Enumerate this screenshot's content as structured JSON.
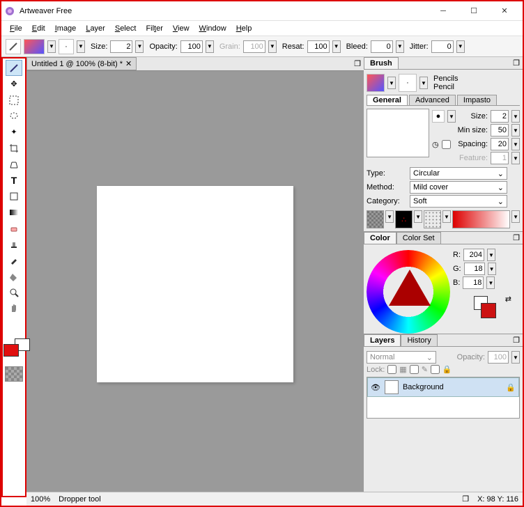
{
  "app": {
    "title": "Artweaver Free"
  },
  "menu": {
    "file": "File",
    "edit": "Edit",
    "image": "Image",
    "layer": "Layer",
    "select": "Select",
    "filter": "Filter",
    "view": "View",
    "window": "Window",
    "help": "Help"
  },
  "options": {
    "size_label": "Size:",
    "size": "2",
    "opacity_label": "Opacity:",
    "opacity": "100",
    "grain_label": "Grain:",
    "grain": "100",
    "resat_label": "Resat:",
    "resat": "100",
    "bleed_label": "Bleed:",
    "bleed": "0",
    "jitter_label": "Jitter:",
    "jitter": "0"
  },
  "doc": {
    "tab": "Untitled 1 @ 100% (8-bit) *"
  },
  "brush": {
    "panel": "Brush",
    "variant_group": "Pencils",
    "variant": "Pencil",
    "sub": {
      "general": "General",
      "advanced": "Advanced",
      "impasto": "Impasto"
    },
    "size_label": "Size:",
    "size": "2",
    "minsize_label": "Min size:",
    "minsize": "50",
    "spacing_label": "Spacing:",
    "spacing": "20",
    "feature_label": "Feature:",
    "feature": "1",
    "type_label": "Type:",
    "type": "Circular",
    "method_label": "Method:",
    "method": "Mild cover",
    "category_label": "Category:",
    "category": "Soft"
  },
  "color": {
    "panel": "Color",
    "set": "Color Set",
    "r_label": "R:",
    "r": "204",
    "g_label": "G:",
    "g": "18",
    "b_label": "B:",
    "b": "18",
    "fg": "#cc1212",
    "bg": "#ffffff"
  },
  "layers": {
    "panel": "Layers",
    "history": "History",
    "blend": "Normal",
    "opacity_label": "Opacity:",
    "opacity": "100",
    "lock": "Lock:",
    "bg": "Background"
  },
  "status": {
    "zoom": "100%",
    "tool": "Dropper tool",
    "coords": "X: 98  Y: 116"
  }
}
